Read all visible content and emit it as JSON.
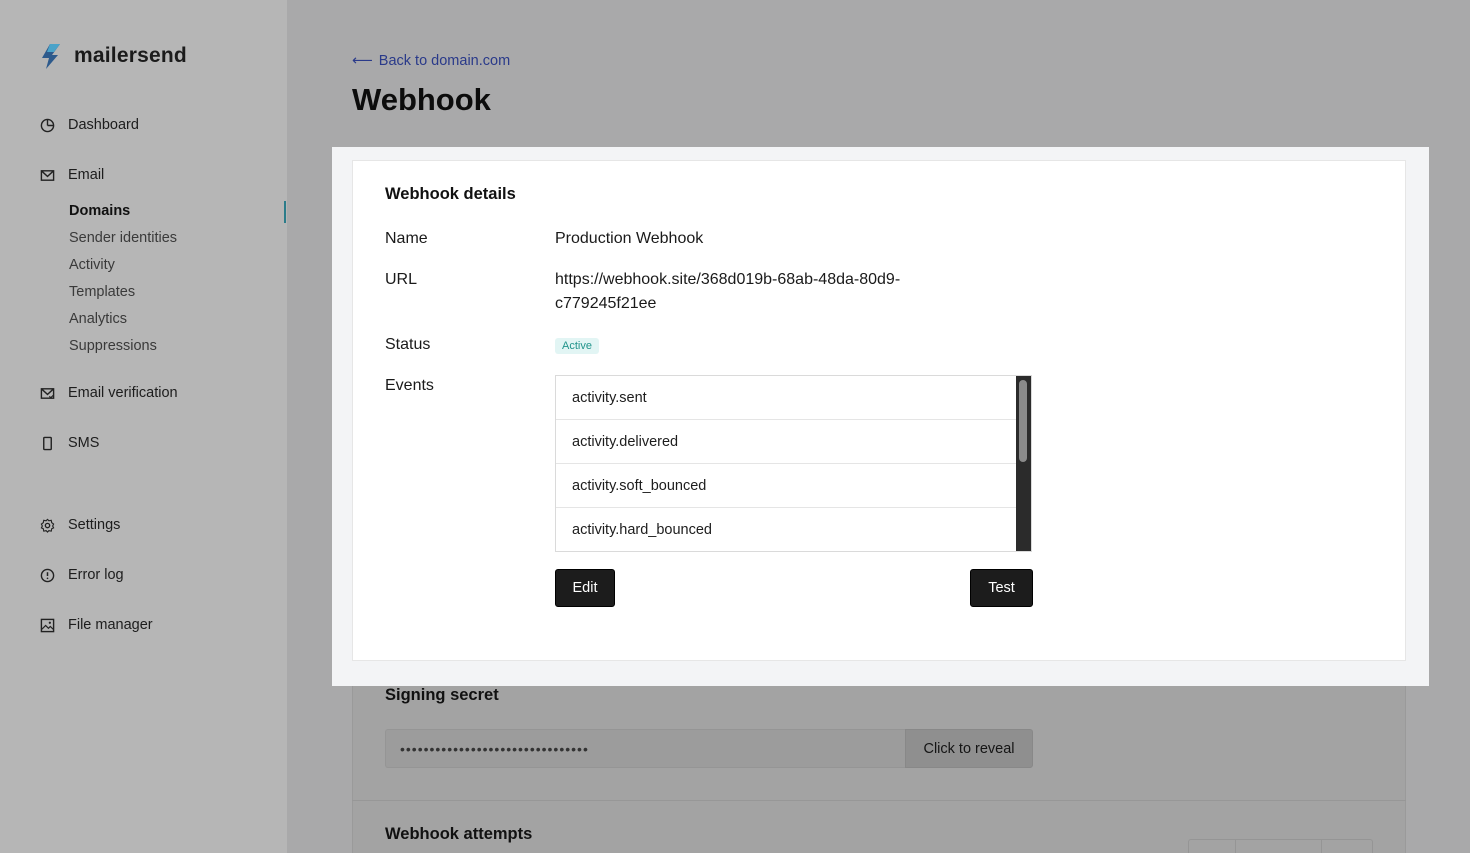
{
  "brand": {
    "name": "mailersend"
  },
  "sidebar": {
    "items": [
      {
        "label": "Dashboard",
        "icon": "chart-pie-icon"
      },
      {
        "label": "Email",
        "icon": "mail-icon"
      },
      {
        "label": "Email verification",
        "icon": "mail-check-icon"
      },
      {
        "label": "SMS",
        "icon": "phone-icon"
      },
      {
        "label": "Settings",
        "icon": "gear-icon"
      },
      {
        "label": "Error log",
        "icon": "alert-circle-icon"
      },
      {
        "label": "File manager",
        "icon": "image-icon"
      }
    ],
    "email_sub": [
      "Domains",
      "Sender identities",
      "Activity",
      "Templates",
      "Analytics",
      "Suppressions"
    ],
    "active_sub": "Domains"
  },
  "header": {
    "back_arrow": "⟵",
    "back_label": "Back to domain.com",
    "title": "Webhook"
  },
  "details": {
    "title": "Webhook details",
    "name_label": "Name",
    "name_value": "Production Webhook",
    "url_label": "URL",
    "url_line1": "https://webhook.site/368d019b-68ab-48da-80d9-",
    "url_line2": "c779245f21ee",
    "status_label": "Status",
    "status_value": "Active",
    "events_label": "Events",
    "events": [
      "activity.sent",
      "activity.delivered",
      "activity.soft_bounced",
      "activity.hard_bounced"
    ],
    "edit_label": "Edit",
    "test_label": "Test"
  },
  "signing": {
    "title": "Signing secret",
    "masked": "••••••••••••••••••••••••••••••••",
    "reveal_label": "Click to reveal"
  },
  "attempts": {
    "title": "Webhook attempts"
  },
  "colors": {
    "accent": "#2b7c8a",
    "badge_text": "#21948b",
    "badge_bg": "#e2f5f4",
    "link": "#2a3a8a"
  }
}
